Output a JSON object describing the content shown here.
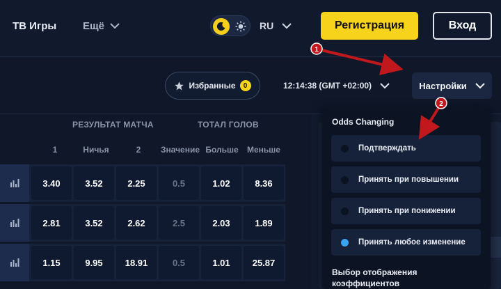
{
  "header": {
    "tv_games": "ТВ Игры",
    "more": "Ещё",
    "lang": "RU",
    "register": "Регистрация",
    "login": "Вход"
  },
  "toolbar": {
    "favorites": "Избранные",
    "favorites_count": "0",
    "clock": "12:14:38 (GMT +02:00)",
    "settings": "Настройки"
  },
  "table": {
    "group_result": "РЕЗУЛЬТАТ МАТЧА",
    "group_total": "ТОТАЛ ГОЛОВ",
    "columns": [
      "1",
      "Ничья",
      "2",
      "Значение",
      "Больше",
      "Меньше"
    ],
    "rows": [
      [
        "3.40",
        "3.52",
        "2.25",
        "0.5",
        "1.02",
        "8.36"
      ],
      [
        "2.81",
        "3.52",
        "2.62",
        "2.5",
        "2.03",
        "1.89"
      ],
      [
        "1.15",
        "9.95",
        "18.91",
        "0.5",
        "1.01",
        "25.87"
      ]
    ]
  },
  "dropdown": {
    "title": "Odds Changing",
    "options": [
      {
        "label": "Подтверждать",
        "selected": false
      },
      {
        "label": "Принять при повышении",
        "selected": false
      },
      {
        "label": "Принять при понижении",
        "selected": false
      },
      {
        "label": "Принять любое изменение",
        "selected": true
      }
    ],
    "subtitle": "Выбор отображения коэффициентов"
  },
  "annotations": {
    "marker1": "1",
    "marker2": "2"
  },
  "colors": {
    "accent": "#f7d31c",
    "background": "#0f1728",
    "radio_selected": "#3aa3f0",
    "annotation": "#c0181c"
  }
}
